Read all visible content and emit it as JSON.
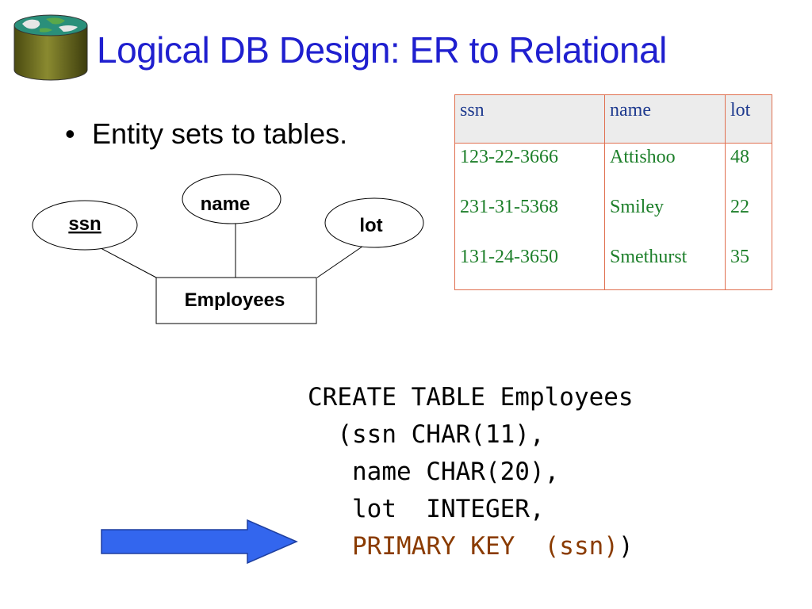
{
  "slide": {
    "title": "Logical DB Design: ER to Relational",
    "bullet": "Entity sets to tables.",
    "bullet_marker": "•"
  },
  "er_diagram": {
    "entity": "Employees",
    "attributes": [
      {
        "label": "ssn",
        "key": true
      },
      {
        "label": "name",
        "key": false
      },
      {
        "label": "lot",
        "key": false
      }
    ]
  },
  "table": {
    "headers": [
      "ssn",
      "name",
      "lot"
    ],
    "rows": [
      [
        "123-22-3666",
        "Attishoo",
        "48"
      ],
      [
        "231-31-5368",
        "Smiley",
        "22"
      ],
      [
        "131-24-3650",
        "Smethurst",
        "35"
      ]
    ]
  },
  "sql": {
    "line1": "CREATE TABLE Employees",
    "line2": "  (ssn CHAR(11),",
    "line3": "   name CHAR(20),",
    "line4": "   lot  INTEGER,",
    "line5_indent": "   ",
    "line5_keyword": "PRIMARY KEY  (ssn)",
    "line5_close": ")"
  },
  "colors": {
    "title": "#1f1fcf",
    "header_text": "#1f3b8f",
    "cell_text": "#1d7f2a",
    "table_border": "#e07050",
    "keyword": "#8a3b00",
    "arrow": "#3366ee"
  },
  "icons": {
    "logo": "database-globe-icon",
    "arrow": "right-arrow-icon"
  }
}
